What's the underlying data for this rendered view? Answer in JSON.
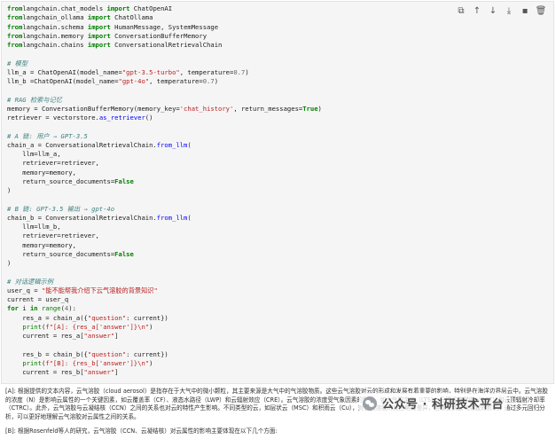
{
  "toolbar": {
    "copy_icon": "⧉",
    "move_up_icon": "↑",
    "move_down_icon": "↓",
    "export_icon": "⤓",
    "save_icon": "▪",
    "delete_icon": "🗑"
  },
  "code": {
    "l01": [
      [
        "kw",
        "from"
      ],
      [
        "",
        "langchain.chat_models "
      ],
      [
        "kw",
        "import"
      ],
      [
        "",
        " ChatOpenAI"
      ]
    ],
    "l02": [
      [
        "kw",
        "from"
      ],
      [
        "",
        "langchain_ollama "
      ],
      [
        "kw",
        "import"
      ],
      [
        "",
        " ChatOllama"
      ]
    ],
    "l03": [
      [
        "kw",
        "from"
      ],
      [
        "",
        "langchain.schema "
      ],
      [
        "kw",
        "import"
      ],
      [
        "",
        " HumanMessage, SystemMessage"
      ]
    ],
    "l04": [
      [
        "kw",
        "from"
      ],
      [
        "",
        "langchain.memory "
      ],
      [
        "kw",
        "import"
      ],
      [
        "",
        " ConversationBufferMemory"
      ]
    ],
    "l05": [
      [
        "kw",
        "from"
      ],
      [
        "",
        "langchain.chains "
      ],
      [
        "kw",
        "import"
      ],
      [
        "",
        " ConversationalRetrievalChain"
      ]
    ],
    "l06": [],
    "l07": [
      [
        "cm",
        "# 模型"
      ]
    ],
    "l08": [
      [
        "",
        "llm_a = ChatOpenAI(model_name="
      ],
      [
        "st",
        "\"gpt-3.5-turbo\""
      ],
      [
        "",
        ", temperature="
      ],
      [
        "num",
        "0.7"
      ],
      [
        "",
        ")"
      ]
    ],
    "l09": [
      [
        "",
        "llm_b =ChatOpenAI(model_name="
      ],
      [
        "st",
        "\"gpt-4o\""
      ],
      [
        "",
        ", temperature="
      ],
      [
        "num",
        "0.7"
      ],
      [
        "",
        ")"
      ]
    ],
    "l10": [],
    "l11": [
      [
        "cm",
        "# RAG 检索与记忆"
      ]
    ],
    "l12": [
      [
        "",
        "memory = ConversationBufferMemory(memory_key="
      ],
      [
        "st",
        "'chat_history'"
      ],
      [
        "",
        ", return_messages="
      ],
      [
        "kw",
        "True"
      ],
      [
        "",
        ")"
      ]
    ],
    "l13": [
      [
        "",
        "retriever = vectorstore."
      ],
      [
        "fn",
        "as_retriever"
      ],
      [
        "",
        "()"
      ]
    ],
    "l14": [],
    "l15": [
      [
        "cm",
        "# A 链: 用户 → GPT-3.5"
      ]
    ],
    "l16": [
      [
        "",
        "chain_a = ConversationalRetrievalChain."
      ],
      [
        "fn",
        "from_llm"
      ],
      [
        "",
        "("
      ]
    ],
    "l17": [
      [
        "",
        "    llm=llm_a,"
      ]
    ],
    "l18": [
      [
        "",
        "    retriever=retriever,"
      ]
    ],
    "l19": [
      [
        "",
        "    memory=memory,"
      ]
    ],
    "l20": [
      [
        "",
        "    return_source_documents="
      ],
      [
        "kw",
        "False"
      ]
    ],
    "l21": [
      [
        "",
        ")"
      ]
    ],
    "l22": [],
    "l23": [
      [
        "cm",
        "# B 链: GPT-3.5 输出 → gpt-4o"
      ]
    ],
    "l24": [
      [
        "",
        "chain_b = ConversationalRetrievalChain."
      ],
      [
        "fn",
        "from_llm"
      ],
      [
        "",
        "("
      ]
    ],
    "l25": [
      [
        "",
        "    llm=llm_b,"
      ]
    ],
    "l26": [
      [
        "",
        "    retriever=retriever,"
      ]
    ],
    "l27": [
      [
        "",
        "    memory=memory,"
      ]
    ],
    "l28": [
      [
        "",
        "    return_source_documents="
      ],
      [
        "kw",
        "False"
      ]
    ],
    "l29": [
      [
        "",
        ")"
      ]
    ],
    "l30": [],
    "l31": [
      [
        "cm",
        "# 对话逻辑示例"
      ]
    ],
    "l32": [
      [
        "",
        "user_q = "
      ],
      [
        "st",
        "\"能不能帮我介绍下云气溶胶的背景知识\""
      ]
    ],
    "l33": [
      [
        "",
        "current = user_q"
      ]
    ],
    "l34": [
      [
        "kw",
        "for"
      ],
      [
        "",
        " i "
      ],
      [
        "kw",
        "in"
      ],
      [
        "",
        " "
      ],
      [
        "bi",
        "range"
      ],
      [
        "",
        "("
      ],
      [
        "num",
        "4"
      ],
      [
        "",
        "):"
      ]
    ],
    "l35": [
      [
        "",
        "    res_a = chain_a({"
      ],
      [
        "st",
        "\"question\""
      ],
      [
        "",
        ": current})"
      ]
    ],
    "l36": [
      [
        "",
        "    "
      ],
      [
        "bi",
        "print"
      ],
      [
        "",
        "("
      ],
      [
        "st",
        "f\"[A]: {res_a['answer']}\\n\""
      ],
      [
        "",
        ")"
      ]
    ],
    "l37": [
      [
        "",
        "    current = res_a["
      ],
      [
        "st",
        "\"answer\""
      ],
      [
        "",
        "]"
      ]
    ],
    "l38": [],
    "l39": [
      [
        "",
        "    res_b = chain_b({"
      ],
      [
        "st",
        "\"question\""
      ],
      [
        "",
        ": current})"
      ]
    ],
    "l40": [
      [
        "",
        "    "
      ],
      [
        "bi",
        "print"
      ],
      [
        "",
        "("
      ],
      [
        "st",
        "f\"[B]: {res_b['answer']}\\n\""
      ],
      [
        "",
        ")"
      ]
    ],
    "l41": [
      [
        "",
        "    current = res_b["
      ],
      [
        "st",
        "\"answer\""
      ],
      [
        "",
        "]"
      ]
    ]
  },
  "output": {
    "para1": "[A]: 根据提供的文本内容，云气溶胶（cloud aerosol）是指存在于大气中的微小颗粒，其主要来源是大气中的气溶胶物质。这些云气溶胶对云的形成和发展有着重要的影响，特别是在海洋边界层云中。云气溶胶的浓度（N）是影响云属性的一个关键因素，如云覆盖率（CF）、液态水路径（LWP）和云辐射效应（CRE）。云气溶胶的浓度受气象因素的影响，如大气稳定度（LTS）、云顶温度梯度（CGT）和云顶辐射冷却率（CTRC）。此外，云气溶胶与云凝结核（CCN）之间的关系也对云的特性产生影响。不同类型的云，如层状云（MSC）和积雨云（Cu），对云气溶胶的反应略有差异，但都受到云气溶胶的影响。通过多元回归分析，可以更好地理解云气溶胶对云属性之间的关系。",
    "para2": "[B]: 根据Rosenfeld等人的研究，云气溶胶（CCN、云凝结核）对云属性的影响主要体现在以下几个方面:"
  },
  "watermark": {
    "text": "公众号 · 科研技术平台"
  }
}
